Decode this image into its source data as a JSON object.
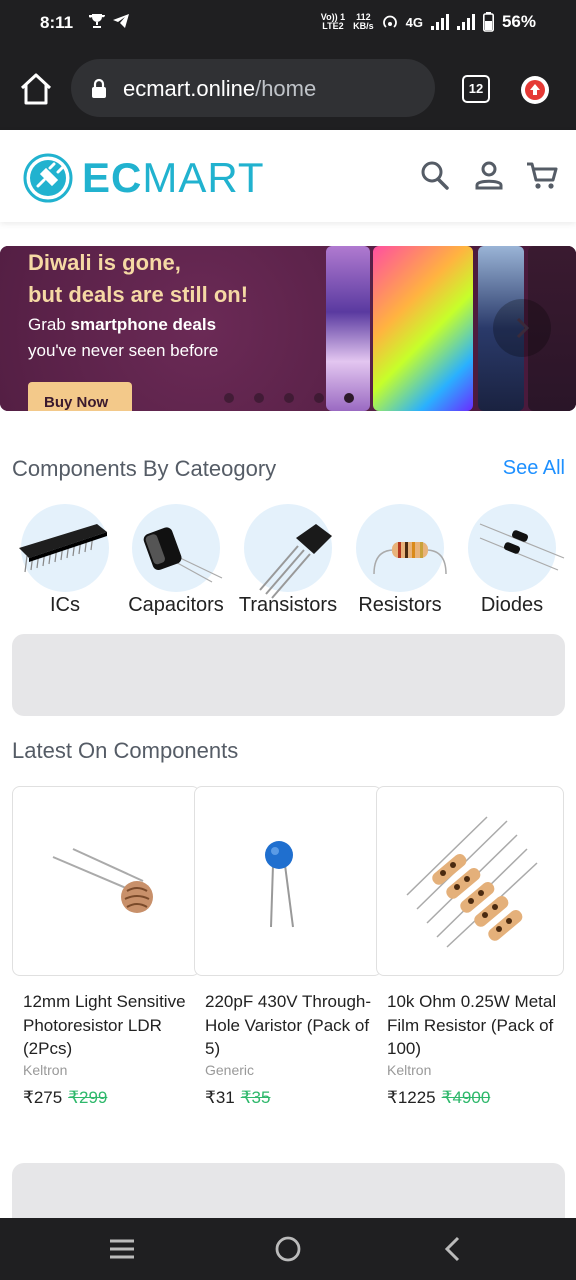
{
  "status": {
    "time": "8:11",
    "lte_top": "Vo)) 1",
    "lte_bottom": "LTE2",
    "speed_top": "112",
    "speed_bottom": "KB/s",
    "network": "4G",
    "battery": "56%"
  },
  "browser": {
    "url_domain": "ecmart.online",
    "url_path": "/home",
    "tab_count": "12"
  },
  "site": {
    "logo_ec": "EC",
    "logo_mart": "MART",
    "brand_color": "#21b2cf"
  },
  "banner": {
    "line1": "Diwali is gone,",
    "line2": "but deals are still on!",
    "line3a": "Grab ",
    "line3b": "smartphone deals",
    "line4": "you've never seen before",
    "cta": "Buy Now",
    "active_slide": 5,
    "slide_count": 5
  },
  "categories": {
    "title": "Components By Cateogory",
    "see_all": "See All",
    "items": [
      {
        "label": "ICs",
        "icon": "ic-chip-icon"
      },
      {
        "label": "Capacitors",
        "icon": "capacitor-icon"
      },
      {
        "label": "Transistors",
        "icon": "transistor-icon"
      },
      {
        "label": "Resistors",
        "icon": "resistor-icon"
      },
      {
        "label": "Diodes",
        "icon": "diode-icon"
      }
    ]
  },
  "latest": {
    "title": "Latest On Components",
    "products": [
      {
        "name": "12mm Light Sensitive Photoresistor LDR (2Pcs)",
        "brand": "Keltron",
        "price": "₹275",
        "old_price": "₹299"
      },
      {
        "name": "220pF 430V Through-Hole Varistor (Pack of 5)",
        "brand": "Generic",
        "price": "₹31",
        "old_price": "₹35"
      },
      {
        "name": "10k Ohm 0.25W Metal Film Resistor (Pack of 100)",
        "brand": "Keltron",
        "price": "₹1225",
        "old_price": "₹4900"
      }
    ]
  }
}
